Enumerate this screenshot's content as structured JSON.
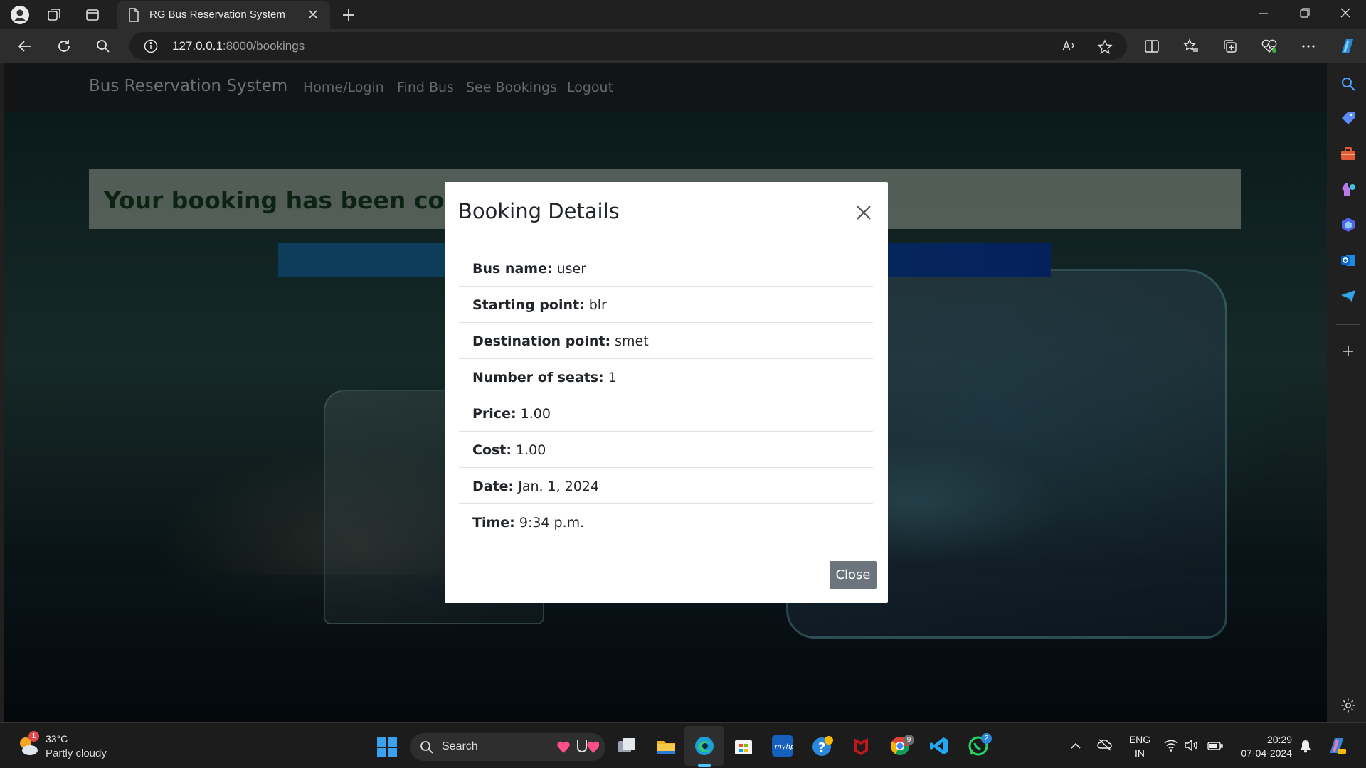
{
  "browser": {
    "tab_title": "RG Bus Reservation System",
    "url_host": "127.0.0.1",
    "url_rest": ":8000/bookings"
  },
  "navbar": {
    "brand": "Bus Reservation System",
    "links": [
      "Home/Login",
      "Find Bus",
      "See Bookings",
      "Logout"
    ]
  },
  "alert": {
    "text": "Your booking has been confirmed"
  },
  "modal": {
    "title": "Booking Details",
    "rows": [
      {
        "key": "Bus name:",
        "value": "user"
      },
      {
        "key": "Starting point:",
        "value": "blr"
      },
      {
        "key": "Destination point:",
        "value": "smet"
      },
      {
        "key": "Number of seats:",
        "value": "1"
      },
      {
        "key": "Price:",
        "value": "1.00"
      },
      {
        "key": "Cost:",
        "value": "1.00"
      },
      {
        "key": "Date:",
        "value": "Jan. 1, 2024"
      },
      {
        "key": "Time:",
        "value": "9:34 p.m."
      }
    ],
    "close_label": "Close"
  },
  "taskbar": {
    "weather_temp": "33°C",
    "weather_desc": "Partly cloudy",
    "weather_badge": "1",
    "search_label": "Search",
    "chrome_badge": "9",
    "whatsapp_badge": "2",
    "lang_top": "ENG",
    "lang_bottom": "IN",
    "time": "20:29",
    "date": "07-04-2024"
  },
  "colors": {
    "navbar_bg": "#212529",
    "alert_text": "#163f22",
    "close_button_bg": "#6c757d",
    "primary_bar": "#0a49a8"
  }
}
